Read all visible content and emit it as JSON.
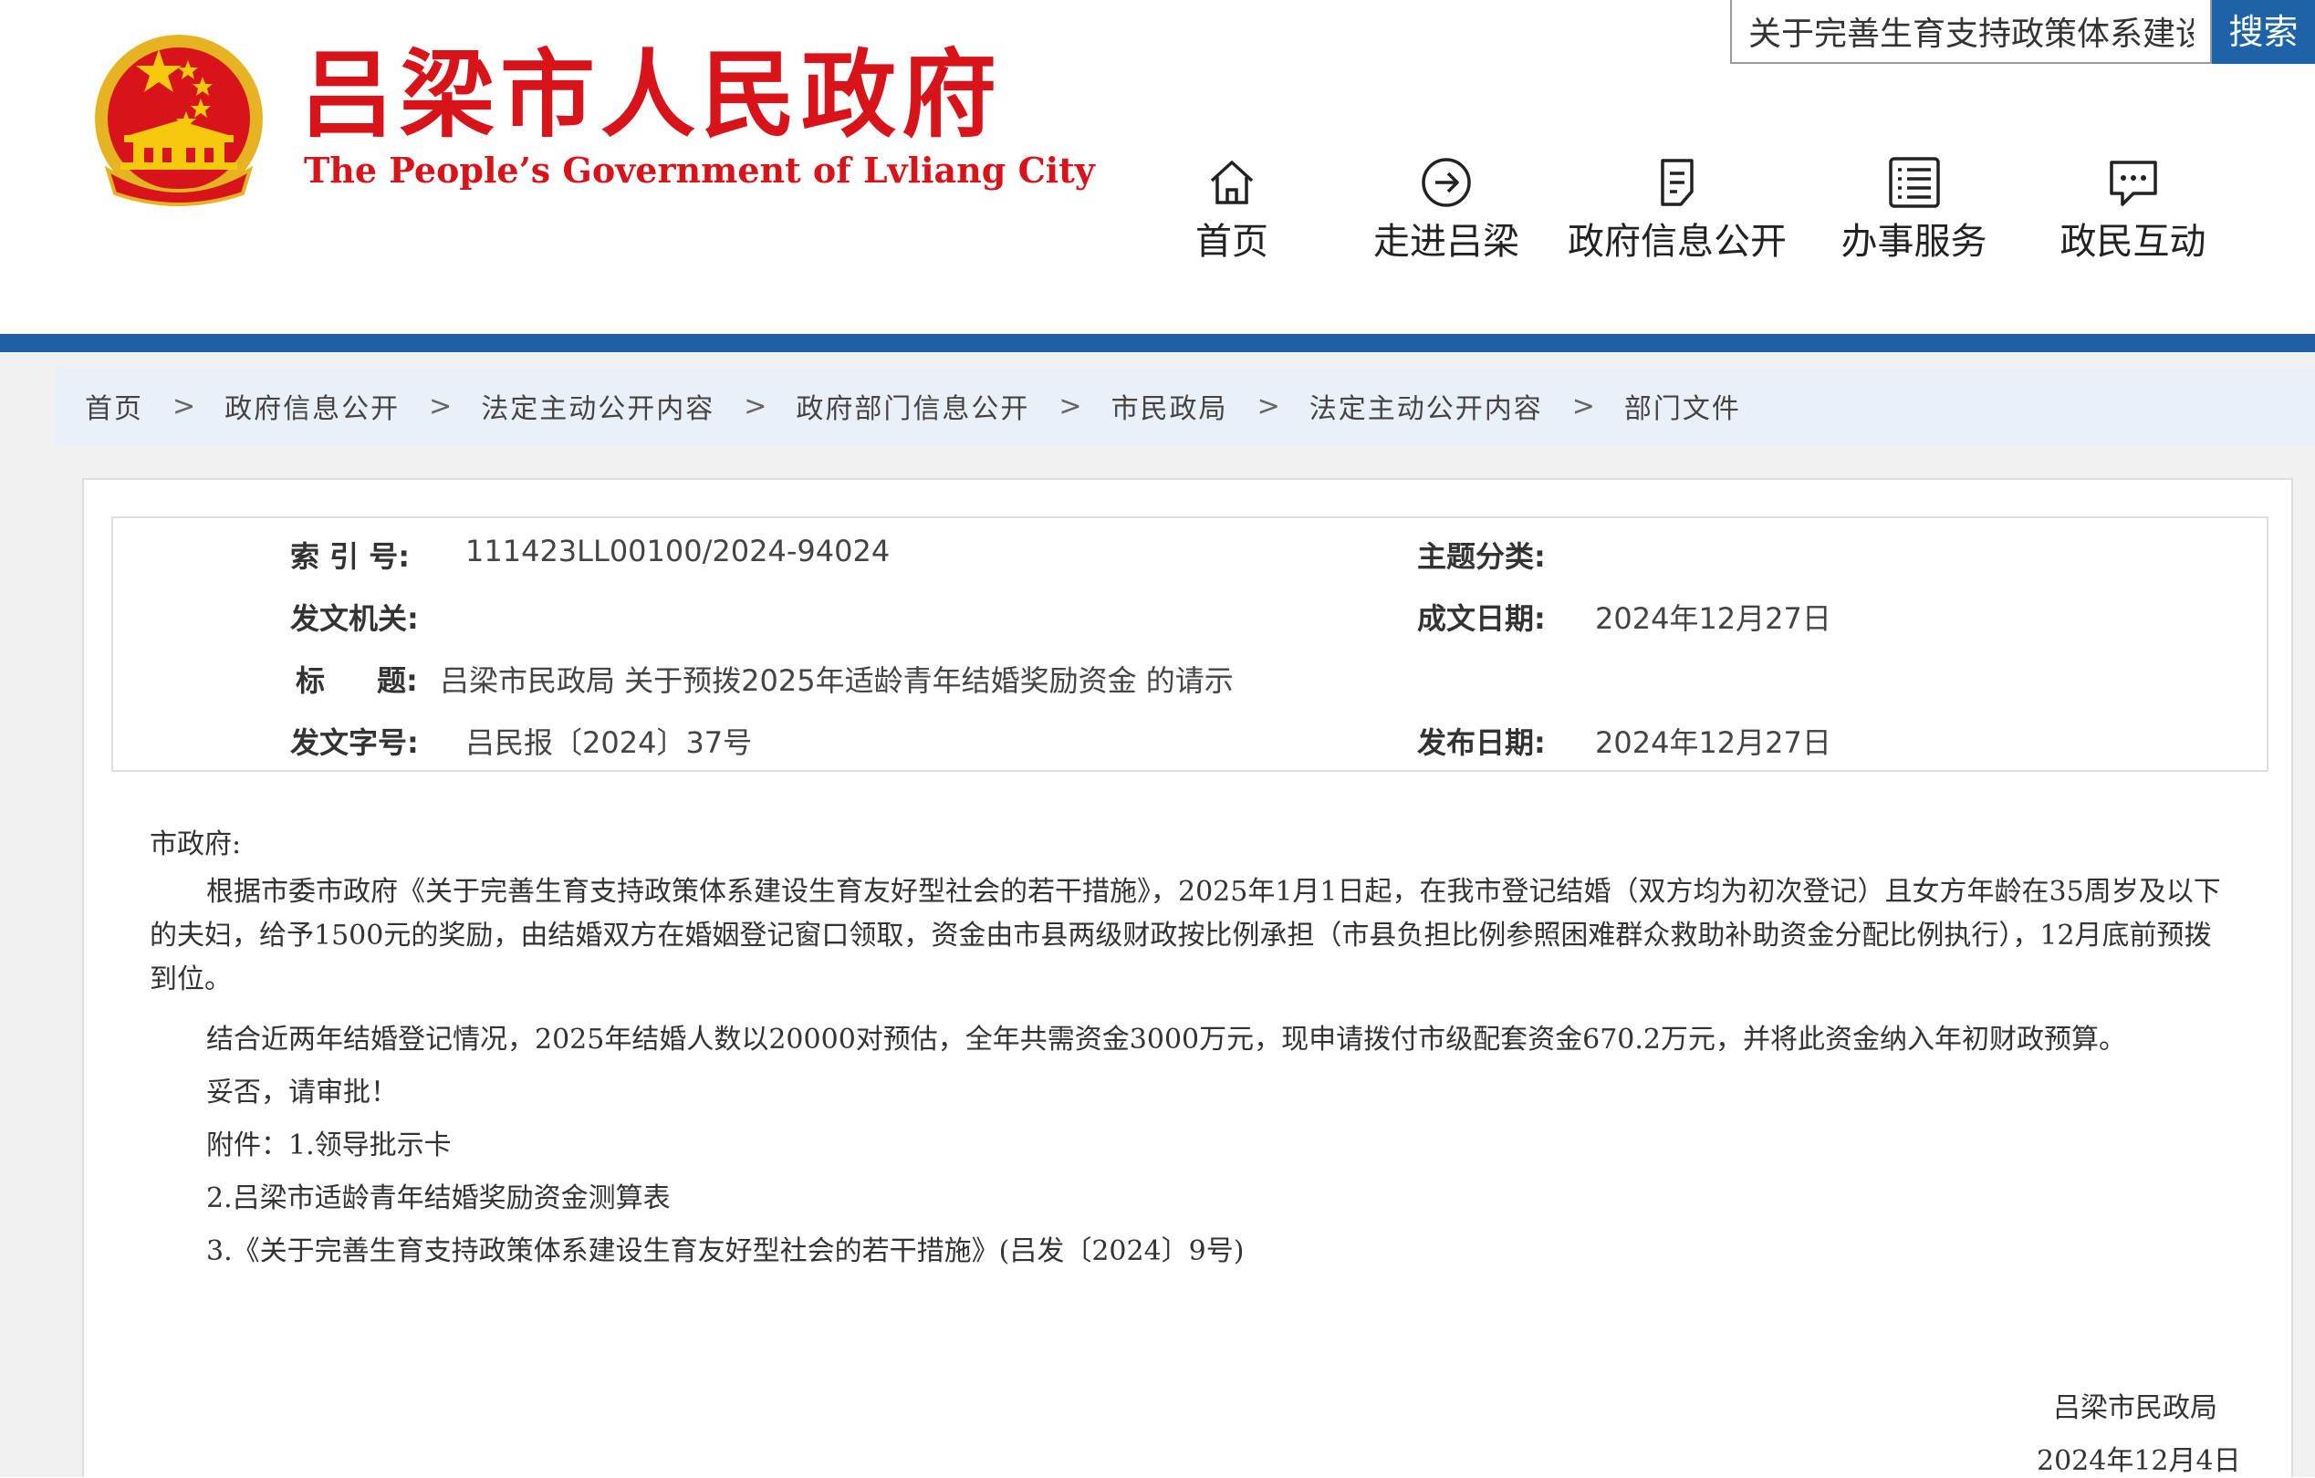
{
  "header": {
    "title_cn": "吕梁市人民政府",
    "title_en": "The People’s Government of Lvliang City",
    "search": {
      "value": "关于完善生育支持政策体系建设",
      "button_label": "搜索"
    },
    "colors": {
      "brand_red": "#d8141b",
      "nav_blue": "#1e5fa5",
      "search_blue": "#1e63a7"
    },
    "nav": [
      {
        "label": "首页",
        "icon": "home-icon"
      },
      {
        "label": "走进吕梁",
        "icon": "arrow-circle-icon"
      },
      {
        "label": "政府信息公开",
        "icon": "document-icon"
      },
      {
        "label": "办事服务",
        "icon": "list-icon"
      },
      {
        "label": "政民互动",
        "icon": "chat-icon"
      }
    ]
  },
  "breadcrumb": [
    "首页",
    "政府信息公开",
    "法定主动公开内容",
    "政府部门信息公开",
    "市民政局",
    "法定主动公开内容",
    "部门文件"
  ],
  "breadcrumb_separator": ">",
  "meta": {
    "index_label": "索 引 号:",
    "index_value": "111423LL00100/2024-94024",
    "topic_label": "主题分类:",
    "topic_value": "",
    "issuer_label": "发文机关:",
    "issuer_value": "",
    "created_label": "成文日期:",
    "created_value": "2024年12月27日",
    "title_label_a": "标",
    "title_label_b": "题:",
    "title_value": "吕梁市民政局 关于预拨2025年适龄青年结婚奖励资金 的请示",
    "docno_label": "发文字号:",
    "docno_value": "吕民报〔2024〕37号",
    "published_label": "发布日期:",
    "published_value": "2024年12月27日"
  },
  "document": {
    "salutation": "市政府:",
    "paragraph1": "根据市委市政府《关于完善生育支持政策体系建设生育友好型社会的若干措施》，2025年1月1日起，在我市登记结婚（双方均为初次登记）且女方年龄在35周岁及以下的夫妇，给予1500元的奖励，由结婚双方在婚姻登记窗口领取，资金由市县两级财政按比例承担（市县负担比例参照困难群众救助补助资金分配比例执行），12月底前预拨到位。",
    "paragraph2": "结合近两年结婚登记情况，2025年结婚人数以20000对预估，全年共需资金3000万元，现申请拨付市级配套资金670.2万元，并将此资金纳入年初财政预算。",
    "request": "妥否，请审批！",
    "attachments": [
      "附件：1.领导批示卡",
      "2.吕梁市适龄青年结婚奖励资金测算表",
      "3.《关于完善生育支持政策体系建设生育友好型社会的若干措施》(吕发〔2024〕9号)"
    ],
    "signature": "吕梁市民政局",
    "date": "2024年12月4日"
  }
}
